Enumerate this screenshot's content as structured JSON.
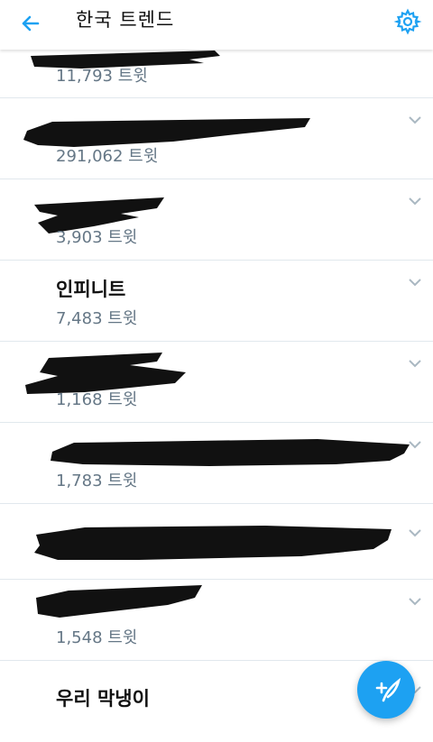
{
  "header": {
    "title": "한국 트렌드",
    "back_icon": "arrow-left-icon",
    "settings_icon": "gear-icon"
  },
  "colors": {
    "accent": "#1da1f2",
    "secondary_text": "#657786",
    "divider": "#e1e8ed"
  },
  "trends": [
    {
      "name": "",
      "count": "11,793 트윗",
      "name_redacted": true
    },
    {
      "name": "",
      "count": "291,062 트윗",
      "name_redacted": true
    },
    {
      "name": "",
      "count": "3,903 트윗",
      "name_redacted": true
    },
    {
      "name": "인피니트",
      "count": "7,483 트윗",
      "name_redacted": false
    },
    {
      "name": "",
      "count": "1,168 트윗",
      "name_redacted": true
    },
    {
      "name": "",
      "count": "1,783 트윗",
      "name_redacted": true
    },
    {
      "name": "",
      "count": "",
      "name_redacted": true
    },
    {
      "name": "",
      "count": "1,548 트윗",
      "name_redacted": true
    },
    {
      "name": "우리 막냉이",
      "count": "",
      "name_redacted": false
    }
  ],
  "fab": {
    "icon": "compose-tweet-icon"
  }
}
